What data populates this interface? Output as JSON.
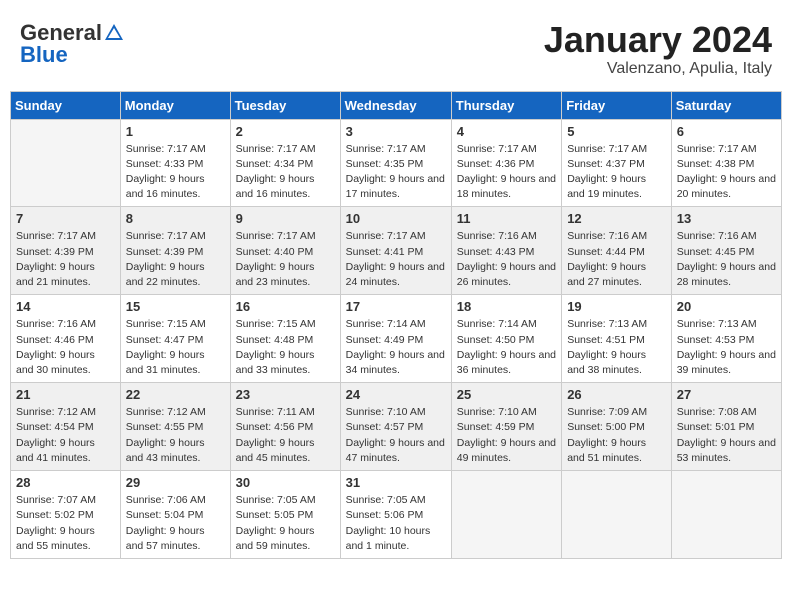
{
  "header": {
    "logo_general": "General",
    "logo_blue": "Blue",
    "month_year": "January 2024",
    "location": "Valenzano, Apulia, Italy"
  },
  "days_of_week": [
    "Sunday",
    "Monday",
    "Tuesday",
    "Wednesday",
    "Thursday",
    "Friday",
    "Saturday"
  ],
  "weeks": [
    [
      {
        "day": "",
        "empty": true
      },
      {
        "day": "1",
        "sunrise": "7:17 AM",
        "sunset": "4:33 PM",
        "daylight": "9 hours and 16 minutes."
      },
      {
        "day": "2",
        "sunrise": "7:17 AM",
        "sunset": "4:34 PM",
        "daylight": "9 hours and 16 minutes."
      },
      {
        "day": "3",
        "sunrise": "7:17 AM",
        "sunset": "4:35 PM",
        "daylight": "9 hours and 17 minutes."
      },
      {
        "day": "4",
        "sunrise": "7:17 AM",
        "sunset": "4:36 PM",
        "daylight": "9 hours and 18 minutes."
      },
      {
        "day": "5",
        "sunrise": "7:17 AM",
        "sunset": "4:37 PM",
        "daylight": "9 hours and 19 minutes."
      },
      {
        "day": "6",
        "sunrise": "7:17 AM",
        "sunset": "4:38 PM",
        "daylight": "9 hours and 20 minutes."
      }
    ],
    [
      {
        "day": "7",
        "sunrise": "7:17 AM",
        "sunset": "4:39 PM",
        "daylight": "9 hours and 21 minutes."
      },
      {
        "day": "8",
        "sunrise": "7:17 AM",
        "sunset": "4:39 PM",
        "daylight": "9 hours and 22 minutes."
      },
      {
        "day": "9",
        "sunrise": "7:17 AM",
        "sunset": "4:40 PM",
        "daylight": "9 hours and 23 minutes."
      },
      {
        "day": "10",
        "sunrise": "7:17 AM",
        "sunset": "4:41 PM",
        "daylight": "9 hours and 24 minutes."
      },
      {
        "day": "11",
        "sunrise": "7:16 AM",
        "sunset": "4:43 PM",
        "daylight": "9 hours and 26 minutes."
      },
      {
        "day": "12",
        "sunrise": "7:16 AM",
        "sunset": "4:44 PM",
        "daylight": "9 hours and 27 minutes."
      },
      {
        "day": "13",
        "sunrise": "7:16 AM",
        "sunset": "4:45 PM",
        "daylight": "9 hours and 28 minutes."
      }
    ],
    [
      {
        "day": "14",
        "sunrise": "7:16 AM",
        "sunset": "4:46 PM",
        "daylight": "9 hours and 30 minutes."
      },
      {
        "day": "15",
        "sunrise": "7:15 AM",
        "sunset": "4:47 PM",
        "daylight": "9 hours and 31 minutes."
      },
      {
        "day": "16",
        "sunrise": "7:15 AM",
        "sunset": "4:48 PM",
        "daylight": "9 hours and 33 minutes."
      },
      {
        "day": "17",
        "sunrise": "7:14 AM",
        "sunset": "4:49 PM",
        "daylight": "9 hours and 34 minutes."
      },
      {
        "day": "18",
        "sunrise": "7:14 AM",
        "sunset": "4:50 PM",
        "daylight": "9 hours and 36 minutes."
      },
      {
        "day": "19",
        "sunrise": "7:13 AM",
        "sunset": "4:51 PM",
        "daylight": "9 hours and 38 minutes."
      },
      {
        "day": "20",
        "sunrise": "7:13 AM",
        "sunset": "4:53 PM",
        "daylight": "9 hours and 39 minutes."
      }
    ],
    [
      {
        "day": "21",
        "sunrise": "7:12 AM",
        "sunset": "4:54 PM",
        "daylight": "9 hours and 41 minutes."
      },
      {
        "day": "22",
        "sunrise": "7:12 AM",
        "sunset": "4:55 PM",
        "daylight": "9 hours and 43 minutes."
      },
      {
        "day": "23",
        "sunrise": "7:11 AM",
        "sunset": "4:56 PM",
        "daylight": "9 hours and 45 minutes."
      },
      {
        "day": "24",
        "sunrise": "7:10 AM",
        "sunset": "4:57 PM",
        "daylight": "9 hours and 47 minutes."
      },
      {
        "day": "25",
        "sunrise": "7:10 AM",
        "sunset": "4:59 PM",
        "daylight": "9 hours and 49 minutes."
      },
      {
        "day": "26",
        "sunrise": "7:09 AM",
        "sunset": "5:00 PM",
        "daylight": "9 hours and 51 minutes."
      },
      {
        "day": "27",
        "sunrise": "7:08 AM",
        "sunset": "5:01 PM",
        "daylight": "9 hours and 53 minutes."
      }
    ],
    [
      {
        "day": "28",
        "sunrise": "7:07 AM",
        "sunset": "5:02 PM",
        "daylight": "9 hours and 55 minutes."
      },
      {
        "day": "29",
        "sunrise": "7:06 AM",
        "sunset": "5:04 PM",
        "daylight": "9 hours and 57 minutes."
      },
      {
        "day": "30",
        "sunrise": "7:05 AM",
        "sunset": "5:05 PM",
        "daylight": "9 hours and 59 minutes."
      },
      {
        "day": "31",
        "sunrise": "7:05 AM",
        "sunset": "5:06 PM",
        "daylight": "10 hours and 1 minute."
      },
      {
        "day": "",
        "empty": true
      },
      {
        "day": "",
        "empty": true
      },
      {
        "day": "",
        "empty": true
      }
    ]
  ]
}
